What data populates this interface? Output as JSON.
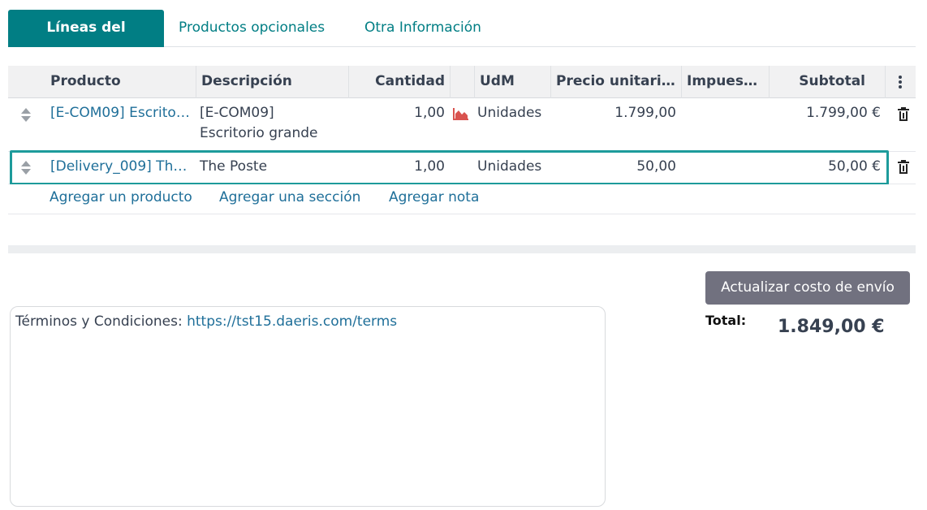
{
  "tabs": [
    {
      "label": "Líneas del pedido",
      "active": true
    },
    {
      "label": "Productos opcionales",
      "active": false
    },
    {
      "label": "Otra Información",
      "active": false
    }
  ],
  "table": {
    "columns": [
      "Producto",
      "Descripción",
      "Cantidad",
      "UdM",
      "Precio unitario…",
      "Impuest…",
      "Subtotal"
    ],
    "rows": [
      {
        "product": "[E-COM09] Escrito…",
        "description_line1": "[E-COM09]",
        "description_line2": "Escritorio grande",
        "quantity": "1,00",
        "uom": "Unidades",
        "unit_price": "1.799,00",
        "taxes": "",
        "subtotal": "1.799,00 €",
        "has_forecast_icon": true
      },
      {
        "product": "[Delivery_009] Th…",
        "description_line1": "The Poste",
        "quantity": "1,00",
        "uom": "Unidades",
        "unit_price": "50,00",
        "taxes": "",
        "subtotal": "50,00 €",
        "selected": true
      }
    ],
    "add_links": {
      "product": "Agregar un producto",
      "section": "Agregar una sección",
      "note": "Agregar nota"
    }
  },
  "footer": {
    "update_shipping_button": "Actualizar costo de envío",
    "total_label": "Total:",
    "total_value": "1.849,00 €",
    "terms_prefix": "Términos y Condiciones: ",
    "terms_link": "https://tst15.daeris.com/terms"
  },
  "colors": {
    "accent": "#017e84",
    "link": "#1f6f99",
    "selection_outline": "#1d9b9b",
    "forecast_icon": "#d9534f",
    "button_bg": "#71717f"
  },
  "icons": [
    "drag-handle-icon",
    "forecast-chart-icon",
    "trash-icon",
    "kebab-menu-icon"
  ]
}
